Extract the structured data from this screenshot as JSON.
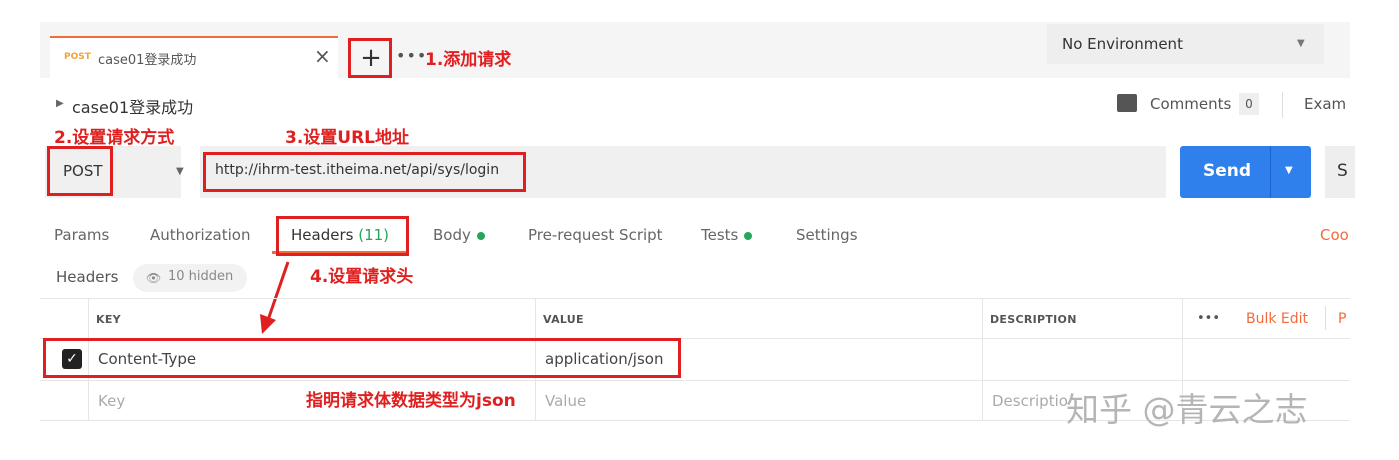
{
  "tab": {
    "method": "POST",
    "title": "case01登录成功",
    "close": "×"
  },
  "new_tab": {
    "plus": "+",
    "more": "•••"
  },
  "environment": {
    "selected": "No Environment"
  },
  "request": {
    "name": "case01登录成功",
    "method": "POST",
    "url": "http://ihrm-test.itheima.net/api/sys/login"
  },
  "comments": {
    "label": "Comments",
    "count": "0"
  },
  "examples_label": "Exam",
  "send": {
    "label": "Send",
    "save_label": "S"
  },
  "request_tabs": [
    {
      "label": "Params"
    },
    {
      "label": "Authorization"
    },
    {
      "label": "Headers",
      "count": "(11)"
    },
    {
      "label": "Body"
    },
    {
      "label": "Pre-request Script"
    },
    {
      "label": "Tests"
    },
    {
      "label": "Settings"
    }
  ],
  "cookies_label": "Coo",
  "headers_section": {
    "label": "Headers",
    "hidden": "10 hidden"
  },
  "table": {
    "columns": [
      "KEY",
      "VALUE",
      "DESCRIPTION"
    ],
    "bulk_edit": "Bulk Edit",
    "presets": "P",
    "more": "•••",
    "rows": [
      {
        "checked": true,
        "key": "Content-Type",
        "value": "application/json",
        "description": ""
      }
    ],
    "placeholders": {
      "key": "Key",
      "value": "Value",
      "description": "Descriptio"
    }
  },
  "annotations": {
    "add_request": "1.添加请求",
    "set_method": "2.设置请求方式",
    "set_url": "3.设置URL地址",
    "set_headers": "4.设置请求头",
    "json_note": "指明请求体数据类型为json"
  },
  "watermark": "知乎 @青云之志",
  "colors": {
    "accent": "#f26b3a",
    "send": "#2f80ed",
    "annotation": "#e02020",
    "success": "#26a65b"
  }
}
